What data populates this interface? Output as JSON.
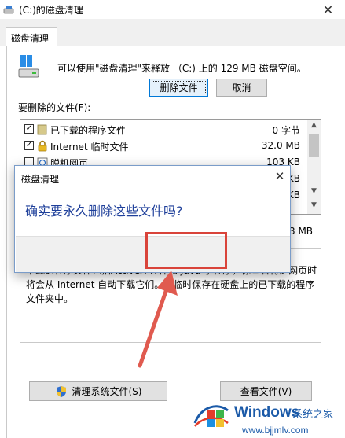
{
  "window": {
    "title": "(C:)的磁盘清理",
    "tab_label": "磁盘清理"
  },
  "main": {
    "summary": "可以使用\"磁盘清理\"来释放 （C:) 上的 129 MB 磁盘空间。",
    "list_label": "要删除的文件(F):",
    "files": [
      {
        "name": "已下载的程序文件",
        "size": "0 字节",
        "checked": true,
        "icon": "folder-icon"
      },
      {
        "name": "Internet 临时文件",
        "size": "32.0 MB",
        "checked": true,
        "icon": "lock-icon"
      },
      {
        "name": "脱机网页",
        "size": "103 KB",
        "checked": false,
        "icon": "offline-page-icon"
      },
      {
        "name": "",
        "size": "KB",
        "checked": false,
        "icon": ""
      },
      {
        "name": "",
        "size": "KB",
        "checked": false,
        "icon": ""
      }
    ],
    "total_fragment": "3 MB",
    "description": "下载的程序文件包括ActiveX 控件和 Java 小程序，你查看特定网页时将会从 Internet 自动下载它们。并临时保存在硬盘上的已下载的程序文件夹中。",
    "clean_system_label": "清理系统文件(S)",
    "view_files_label": "查看文件(V)"
  },
  "dialog": {
    "title": "磁盘清理",
    "message": "确实要永久删除这些文件吗?",
    "delete_label": "删除文件",
    "cancel_label": "取消"
  },
  "watermark": {
    "brand": "Windows",
    "sub": "系统之家",
    "url": "www.bjjmlv.com"
  },
  "colors": {
    "accent": "#0078d7",
    "dialog_message": "#1e3f9a",
    "highlight": "#d9443a",
    "watermark": "#1b5aa8"
  }
}
